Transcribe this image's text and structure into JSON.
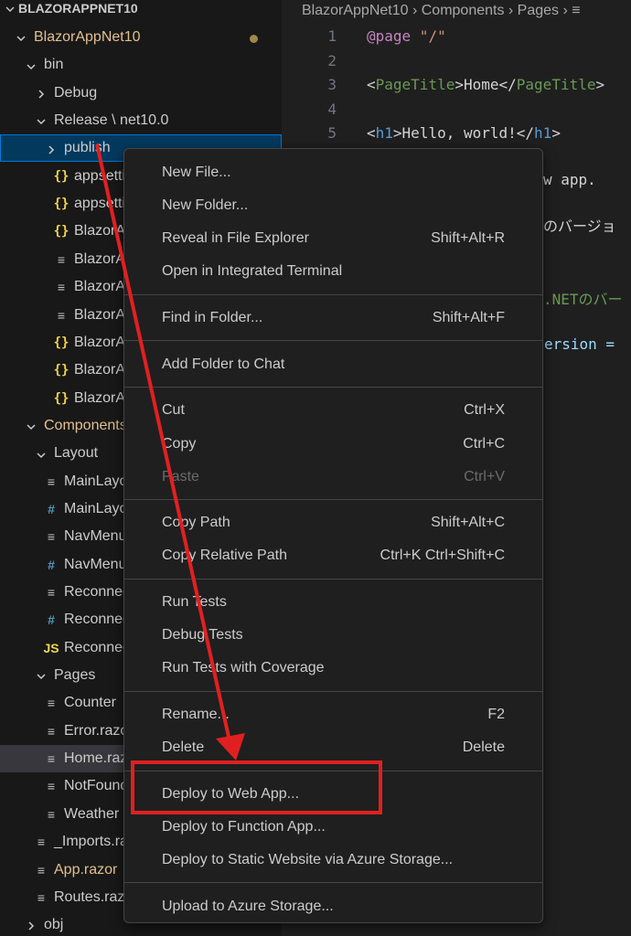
{
  "explorer": {
    "root_title": "BLAZORAPPNET10",
    "items": [
      {
        "label": "BlazorAppNet10",
        "kind": "folder-open",
        "modified": true
      },
      {
        "label": "bin",
        "kind": "folder-open"
      },
      {
        "label": "Debug",
        "kind": "folder-closed"
      },
      {
        "label": "Release \\ net10.0",
        "kind": "folder-open"
      },
      {
        "label": "publish",
        "kind": "folder-closed"
      },
      {
        "label": "appsettings",
        "icon": "json"
      },
      {
        "label": "appsettings",
        "icon": "json"
      },
      {
        "label": "BlazorA",
        "icon": "json"
      },
      {
        "label": "BlazorA",
        "icon": "file"
      },
      {
        "label": "BlazorA",
        "icon": "file"
      },
      {
        "label": "BlazorA",
        "icon": "file"
      },
      {
        "label": "BlazorA",
        "icon": "json"
      },
      {
        "label": "BlazorA",
        "icon": "json"
      },
      {
        "label": "BlazorA",
        "icon": "json"
      },
      {
        "label": "Components",
        "kind": "folder-open",
        "modified": true
      },
      {
        "label": "Layout",
        "kind": "folder-open"
      },
      {
        "label": "MainLayout",
        "icon": "file"
      },
      {
        "label": "MainLayout",
        "icon": "hash"
      },
      {
        "label": "NavMenu",
        "icon": "file"
      },
      {
        "label": "NavMenu",
        "icon": "hash"
      },
      {
        "label": "ReconnectModal",
        "icon": "file"
      },
      {
        "label": "ReconnectModal",
        "icon": "hash"
      },
      {
        "label": "ReconnectModal",
        "icon": "js"
      },
      {
        "label": "Pages",
        "kind": "folder-open"
      },
      {
        "label": "Counter",
        "icon": "file"
      },
      {
        "label": "Error.razor",
        "icon": "file"
      },
      {
        "label": "Home.razor",
        "icon": "file",
        "selected": true
      },
      {
        "label": "NotFound",
        "icon": "file"
      },
      {
        "label": "Weather",
        "icon": "file"
      },
      {
        "label": "_Imports.razor",
        "icon": "file"
      },
      {
        "label": "App.razor",
        "icon": "file",
        "modified": true
      },
      {
        "label": "Routes.razor",
        "icon": "file"
      },
      {
        "label": "obj",
        "kind": "folder-closed"
      }
    ],
    "icon_glyphs": {
      "json": "{}",
      "file": "≡",
      "hash": "#",
      "js": "JS"
    }
  },
  "editor": {
    "breadcrumb": [
      "BlazorAppNet10",
      "Components",
      "Pages"
    ],
    "lines": [
      {
        "n": "1",
        "parts": [
          {
            "t": "@page",
            "c": "kw"
          },
          {
            "t": " \"/\"",
            "c": "str"
          }
        ]
      },
      {
        "n": "2",
        "parts": []
      },
      {
        "n": "3",
        "parts": [
          {
            "t": "<",
            "c": "plain"
          },
          {
            "t": "PageTitle",
            "c": "green"
          },
          {
            "t": ">",
            "c": "plain"
          },
          {
            "t": "Home",
            "c": "txt"
          },
          {
            "t": "</",
            "c": "plain"
          },
          {
            "t": "PageTitle",
            "c": "green"
          },
          {
            "t": ">",
            "c": "plain"
          }
        ]
      },
      {
        "n": "4",
        "parts": []
      },
      {
        "n": "5",
        "parts": [
          {
            "t": "<",
            "c": "plain"
          },
          {
            "t": "h1",
            "c": "tag"
          },
          {
            "t": ">",
            "c": "plain"
          },
          {
            "t": "Hello, world!",
            "c": "txt"
          },
          {
            "t": "</",
            "c": "plain"
          },
          {
            "t": "h1",
            "c": "tag"
          },
          {
            "t": ">",
            "c": "plain"
          }
        ]
      }
    ],
    "peek_fragments": [
      "w app.",
      "のバージョ",
      ".NETのバー",
      "ersion ="
    ]
  },
  "context_menu": {
    "groups": [
      [
        {
          "label": "New File...",
          "key": ""
        },
        {
          "label": "New Folder...",
          "key": ""
        },
        {
          "label": "Reveal in File Explorer",
          "key": "Shift+Alt+R"
        },
        {
          "label": "Open in Integrated Terminal",
          "key": ""
        }
      ],
      [
        {
          "label": "Find in Folder...",
          "key": "Shift+Alt+F"
        }
      ],
      [
        {
          "label": "Add Folder to Chat",
          "key": ""
        }
      ],
      [
        {
          "label": "Cut",
          "key": "Ctrl+X"
        },
        {
          "label": "Copy",
          "key": "Ctrl+C"
        },
        {
          "label": "Paste",
          "key": "Ctrl+V",
          "disabled": true
        }
      ],
      [
        {
          "label": "Copy Path",
          "key": "Shift+Alt+C"
        },
        {
          "label": "Copy Relative Path",
          "key": "Ctrl+K Ctrl+Shift+C"
        }
      ],
      [
        {
          "label": "Run Tests",
          "key": ""
        },
        {
          "label": "Debug Tests",
          "key": ""
        },
        {
          "label": "Run Tests with Coverage",
          "key": ""
        }
      ],
      [
        {
          "label": "Rename...",
          "key": "F2"
        },
        {
          "label": "Delete",
          "key": "Delete"
        }
      ],
      [
        {
          "label": "Deploy to Web App...",
          "key": "",
          "highlighted": true
        },
        {
          "label": "Deploy to Function App...",
          "key": ""
        },
        {
          "label": "Deploy to Static Website via Azure Storage...",
          "key": ""
        }
      ],
      [
        {
          "label": "Upload to Azure Storage...",
          "key": ""
        }
      ]
    ]
  },
  "colors": {
    "annotation": "#e02020",
    "modified": "#e2c08d",
    "menu_bg": "#1f1f1f"
  }
}
